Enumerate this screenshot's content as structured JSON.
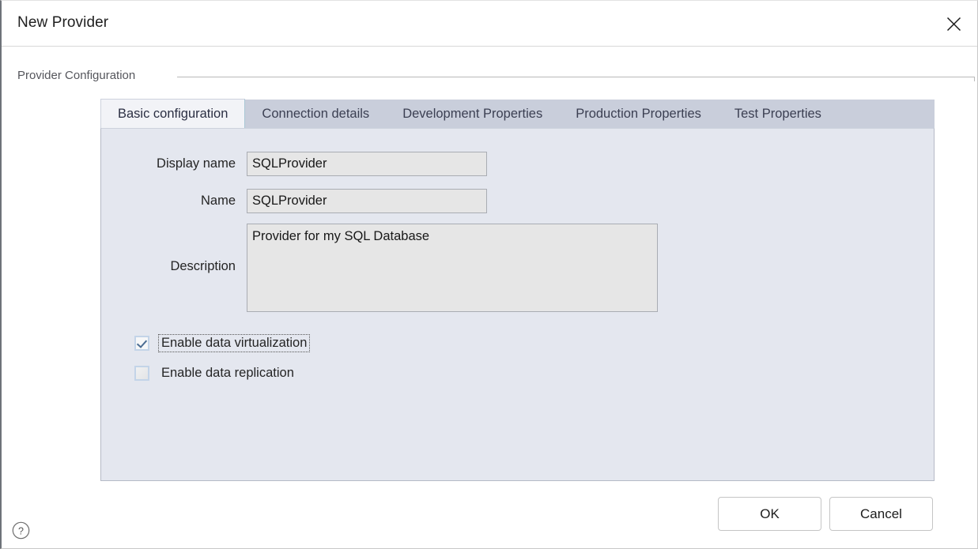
{
  "window": {
    "title": "New Provider",
    "close_icon": "close-icon"
  },
  "group": {
    "legend": "Provider Configuration"
  },
  "tabs": {
    "active_index": 0,
    "items": [
      {
        "label": "Basic configuration"
      },
      {
        "label": "Connection details"
      },
      {
        "label": "Development Properties"
      },
      {
        "label": "Production Properties"
      },
      {
        "label": "Test Properties"
      }
    ]
  },
  "form": {
    "display_name": {
      "label": "Display name",
      "value": "SQLProvider",
      "placeholder": ""
    },
    "name": {
      "label": "Name",
      "value": "SQLProvider",
      "placeholder": ""
    },
    "description": {
      "label": "Description",
      "value": "Provider for my SQL Database",
      "placeholder": ""
    },
    "checkboxes": [
      {
        "label": "Enable data virtualization",
        "checked": true,
        "focused": true
      },
      {
        "label": "Enable data replication",
        "checked": false,
        "focused": false
      }
    ]
  },
  "footer": {
    "ok_label": "OK",
    "cancel_label": "Cancel",
    "help_icon": "help-circle-icon"
  },
  "colors": {
    "panel_background": "#e4e7ef",
    "tabstrip_background": "#c9cedb",
    "active_tab_background": "#f2f3f7",
    "input_background": "#e6e6e6",
    "input_border": "#a9acb3",
    "checkbox_border": "#c3d4e8",
    "checkmark": "#4a6c92",
    "text": "#242424",
    "legend_text": "#55565c"
  }
}
